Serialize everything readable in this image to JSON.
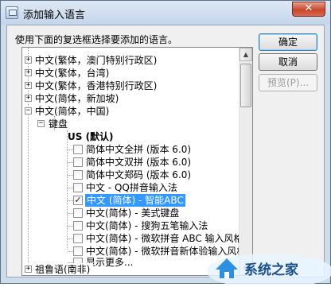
{
  "window": {
    "title": "添加输入语言",
    "close_label": "✕"
  },
  "instruction": "使用下面的复选框选择要添加的语言。",
  "buttons": {
    "ok": "确定",
    "cancel": "取消",
    "preview": "预览(P)..."
  },
  "tree": {
    "nodes": [
      {
        "label": "中文(繁体，澳门特别行政区)",
        "expander": "+"
      },
      {
        "label": "中文(繁体，台湾)",
        "expander": "+"
      },
      {
        "label": "中文(繁体，香港特别行政区)",
        "expander": "+"
      },
      {
        "label": "中文(简体，新加坡)",
        "expander": "+"
      },
      {
        "label": "中文(简体，中国)",
        "expander": "−"
      },
      {
        "label": "键盘",
        "expander": "−"
      },
      {
        "label": "US (默认)"
      },
      {
        "label": "简体中文全拼 (版本 6.0)",
        "checked": false
      },
      {
        "label": "简体中文双拼 (版本 6.0)",
        "checked": false
      },
      {
        "label": "简体中文郑码 (版本 6.0)",
        "checked": false
      },
      {
        "label": "中文 - QQ拼音输入法",
        "checked": false
      },
      {
        "label": "中文 (简体) - 智能ABC",
        "checked": true
      },
      {
        "label": "中文(简体) - 美式键盘",
        "checked": false
      },
      {
        "label": "中文(简体) - 搜狗五笔输入法",
        "checked": false
      },
      {
        "label": "中文(简体) - 微软拼音 ABC 输入风格",
        "checked": false
      },
      {
        "label": "中文(简体) - 微软拼音新体验输入风格",
        "checked": false
      },
      {
        "label": "显示更多...",
        "checked": false
      },
      {
        "label": "祖鲁语(南非)",
        "expander": "+"
      }
    ]
  },
  "scrollbar": {
    "up_arrow": "▲",
    "down_arrow": "▼"
  },
  "watermark": {
    "text": "系统之家"
  }
}
